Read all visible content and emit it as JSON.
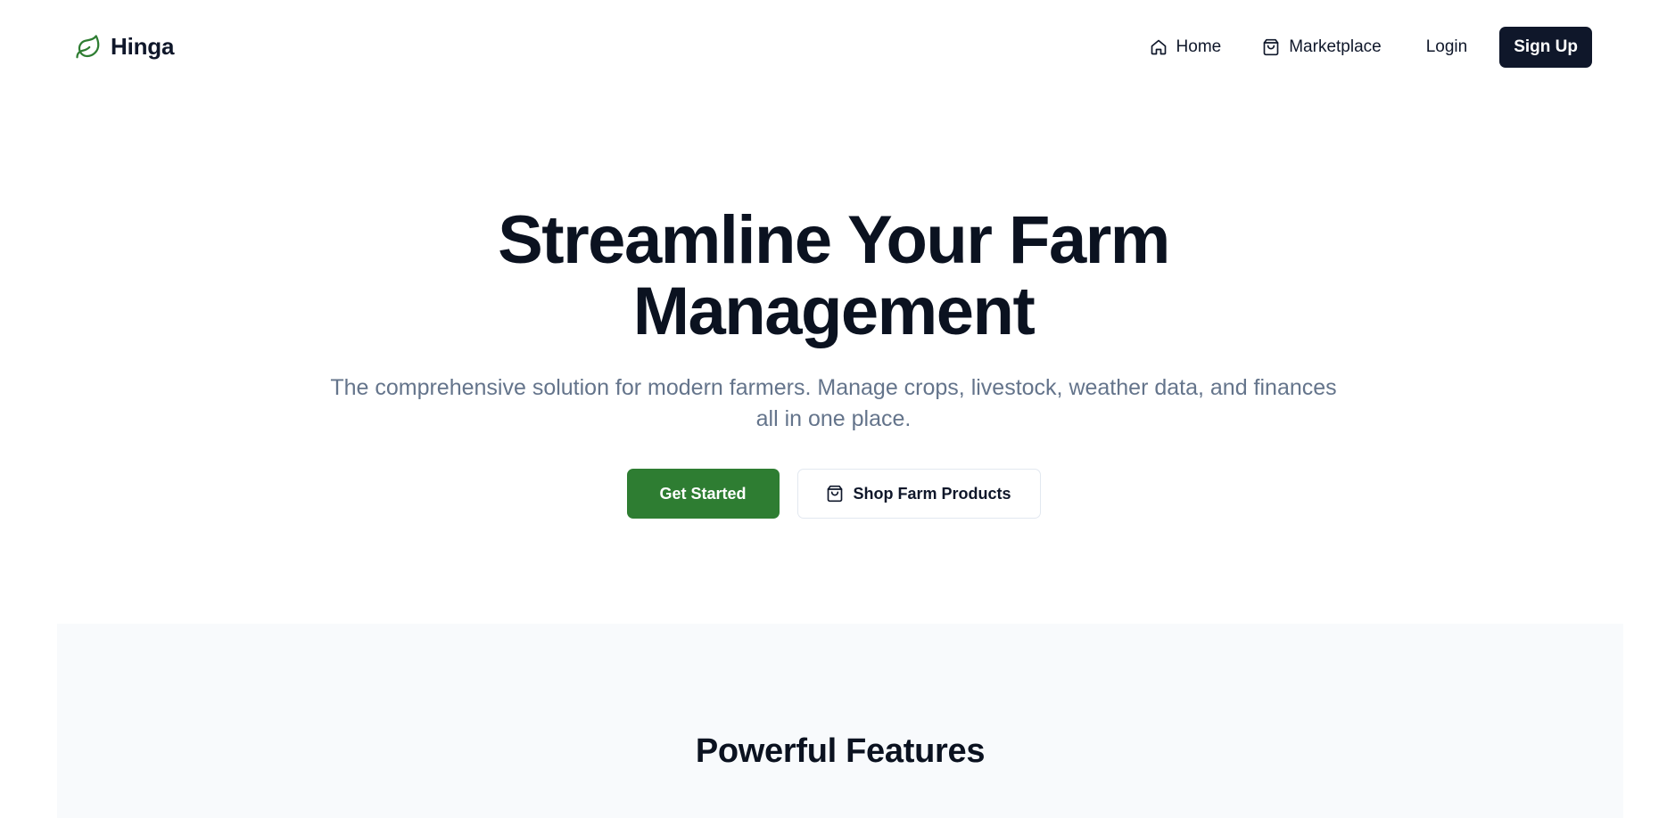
{
  "brand": {
    "name": "Hinga",
    "icon": "leaf-icon",
    "accent_color": "#2e7d32"
  },
  "nav": {
    "home": {
      "label": "Home",
      "icon": "home-icon"
    },
    "marketplace": {
      "label": "Marketplace",
      "icon": "shopping-bag-icon"
    },
    "login": {
      "label": "Login"
    },
    "signup": {
      "label": "Sign Up"
    }
  },
  "hero": {
    "title_line1": "Streamline Your Farm",
    "title_line2": "Management",
    "subtitle": "The comprehensive solution for modern farmers. Manage crops, livestock, weather data, and finances all in one place.",
    "primary_cta": "Get Started",
    "secondary_cta": "Shop Farm Products",
    "secondary_cta_icon": "shopping-bag-icon"
  },
  "features": {
    "heading": "Powerful Features"
  },
  "colors": {
    "primary_green": "#2e7d32",
    "dark": "#0f172a",
    "muted_text": "#64748b",
    "section_bg": "#f8fafc"
  }
}
